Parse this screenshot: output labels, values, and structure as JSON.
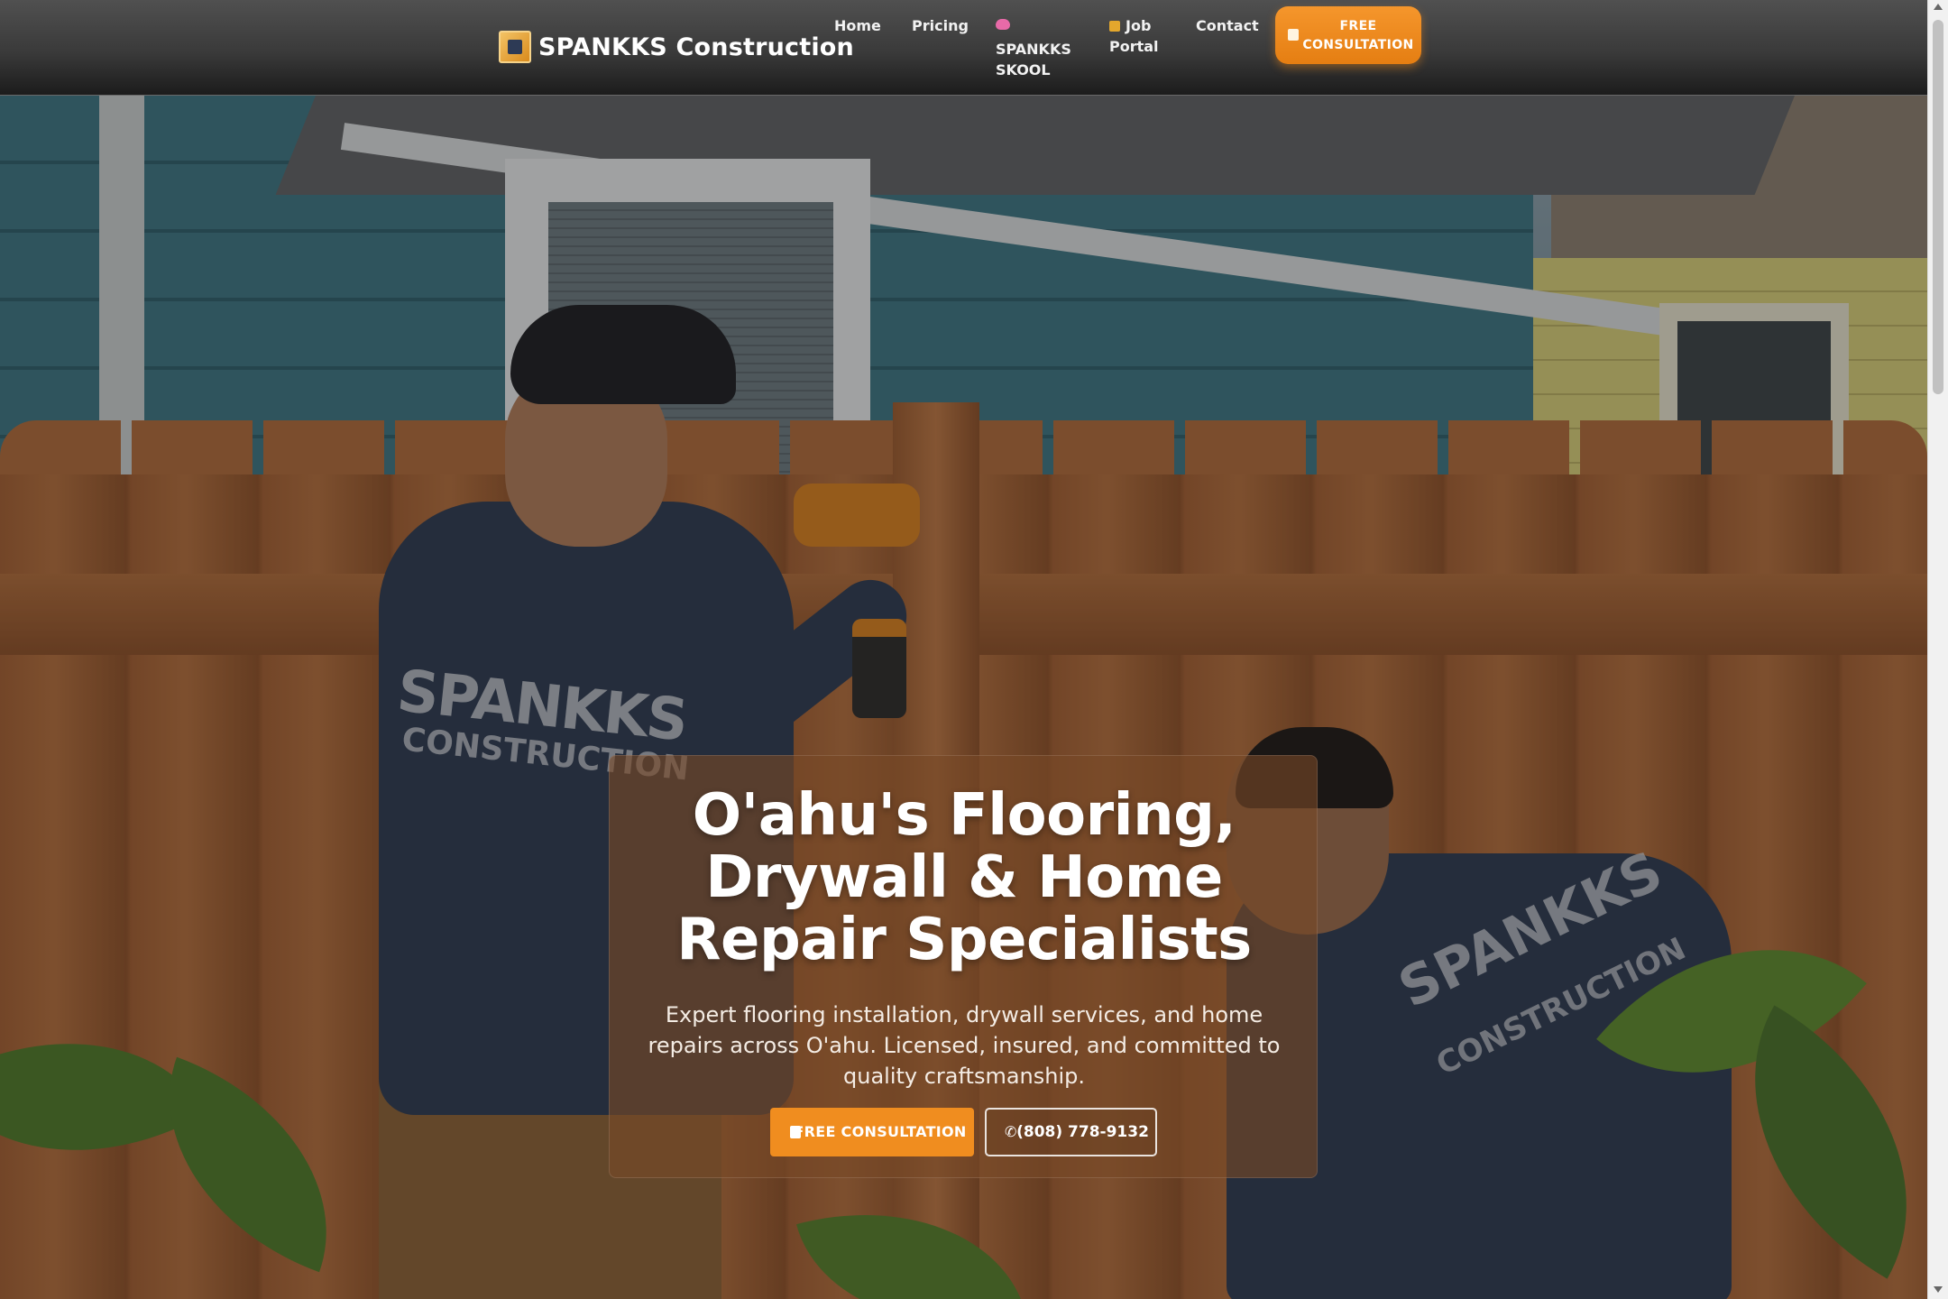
{
  "brand": {
    "name": "SPANKKS Construction",
    "logo_icon": "company-logo"
  },
  "nav": {
    "home": "Home",
    "pricing": "Pricing",
    "skool_icon": "brain-icon",
    "skool_line1": "SPANKKS",
    "skool_line2": "SKOOL",
    "job_icon": "lock-icon",
    "job_line1": "Job",
    "job_line2": "Portal",
    "contact": "Contact",
    "cta_icon": "calendar-icon",
    "cta_line1": "FREE",
    "cta_line2": "CONSULTATION"
  },
  "hero": {
    "title_line1": "O'ahu's Flooring,",
    "title_line2": "Drywall & Home",
    "title_line3": "Repair Specialists",
    "subtitle": "Expert flooring installation, drywall services, and home repairs across O'ahu. Licensed, insured, and committed to quality craftsmanship.",
    "primary_button": "FREE CONSULTATION",
    "primary_icon": "calendar-icon",
    "secondary_button": "(808) 778-9132",
    "secondary_icon": "phone-icon"
  },
  "photo": {
    "shirt_text_1": "SPANKKS",
    "shirt_text_2": "CONSTRUCTION",
    "shirt_text_3": "SPANKKS",
    "shirt_text_4": "CONSTRUCTION"
  },
  "colors": {
    "accent": "#f08d1f",
    "nav_bg": "#3a3a3a",
    "card_bg": "#78482a"
  }
}
